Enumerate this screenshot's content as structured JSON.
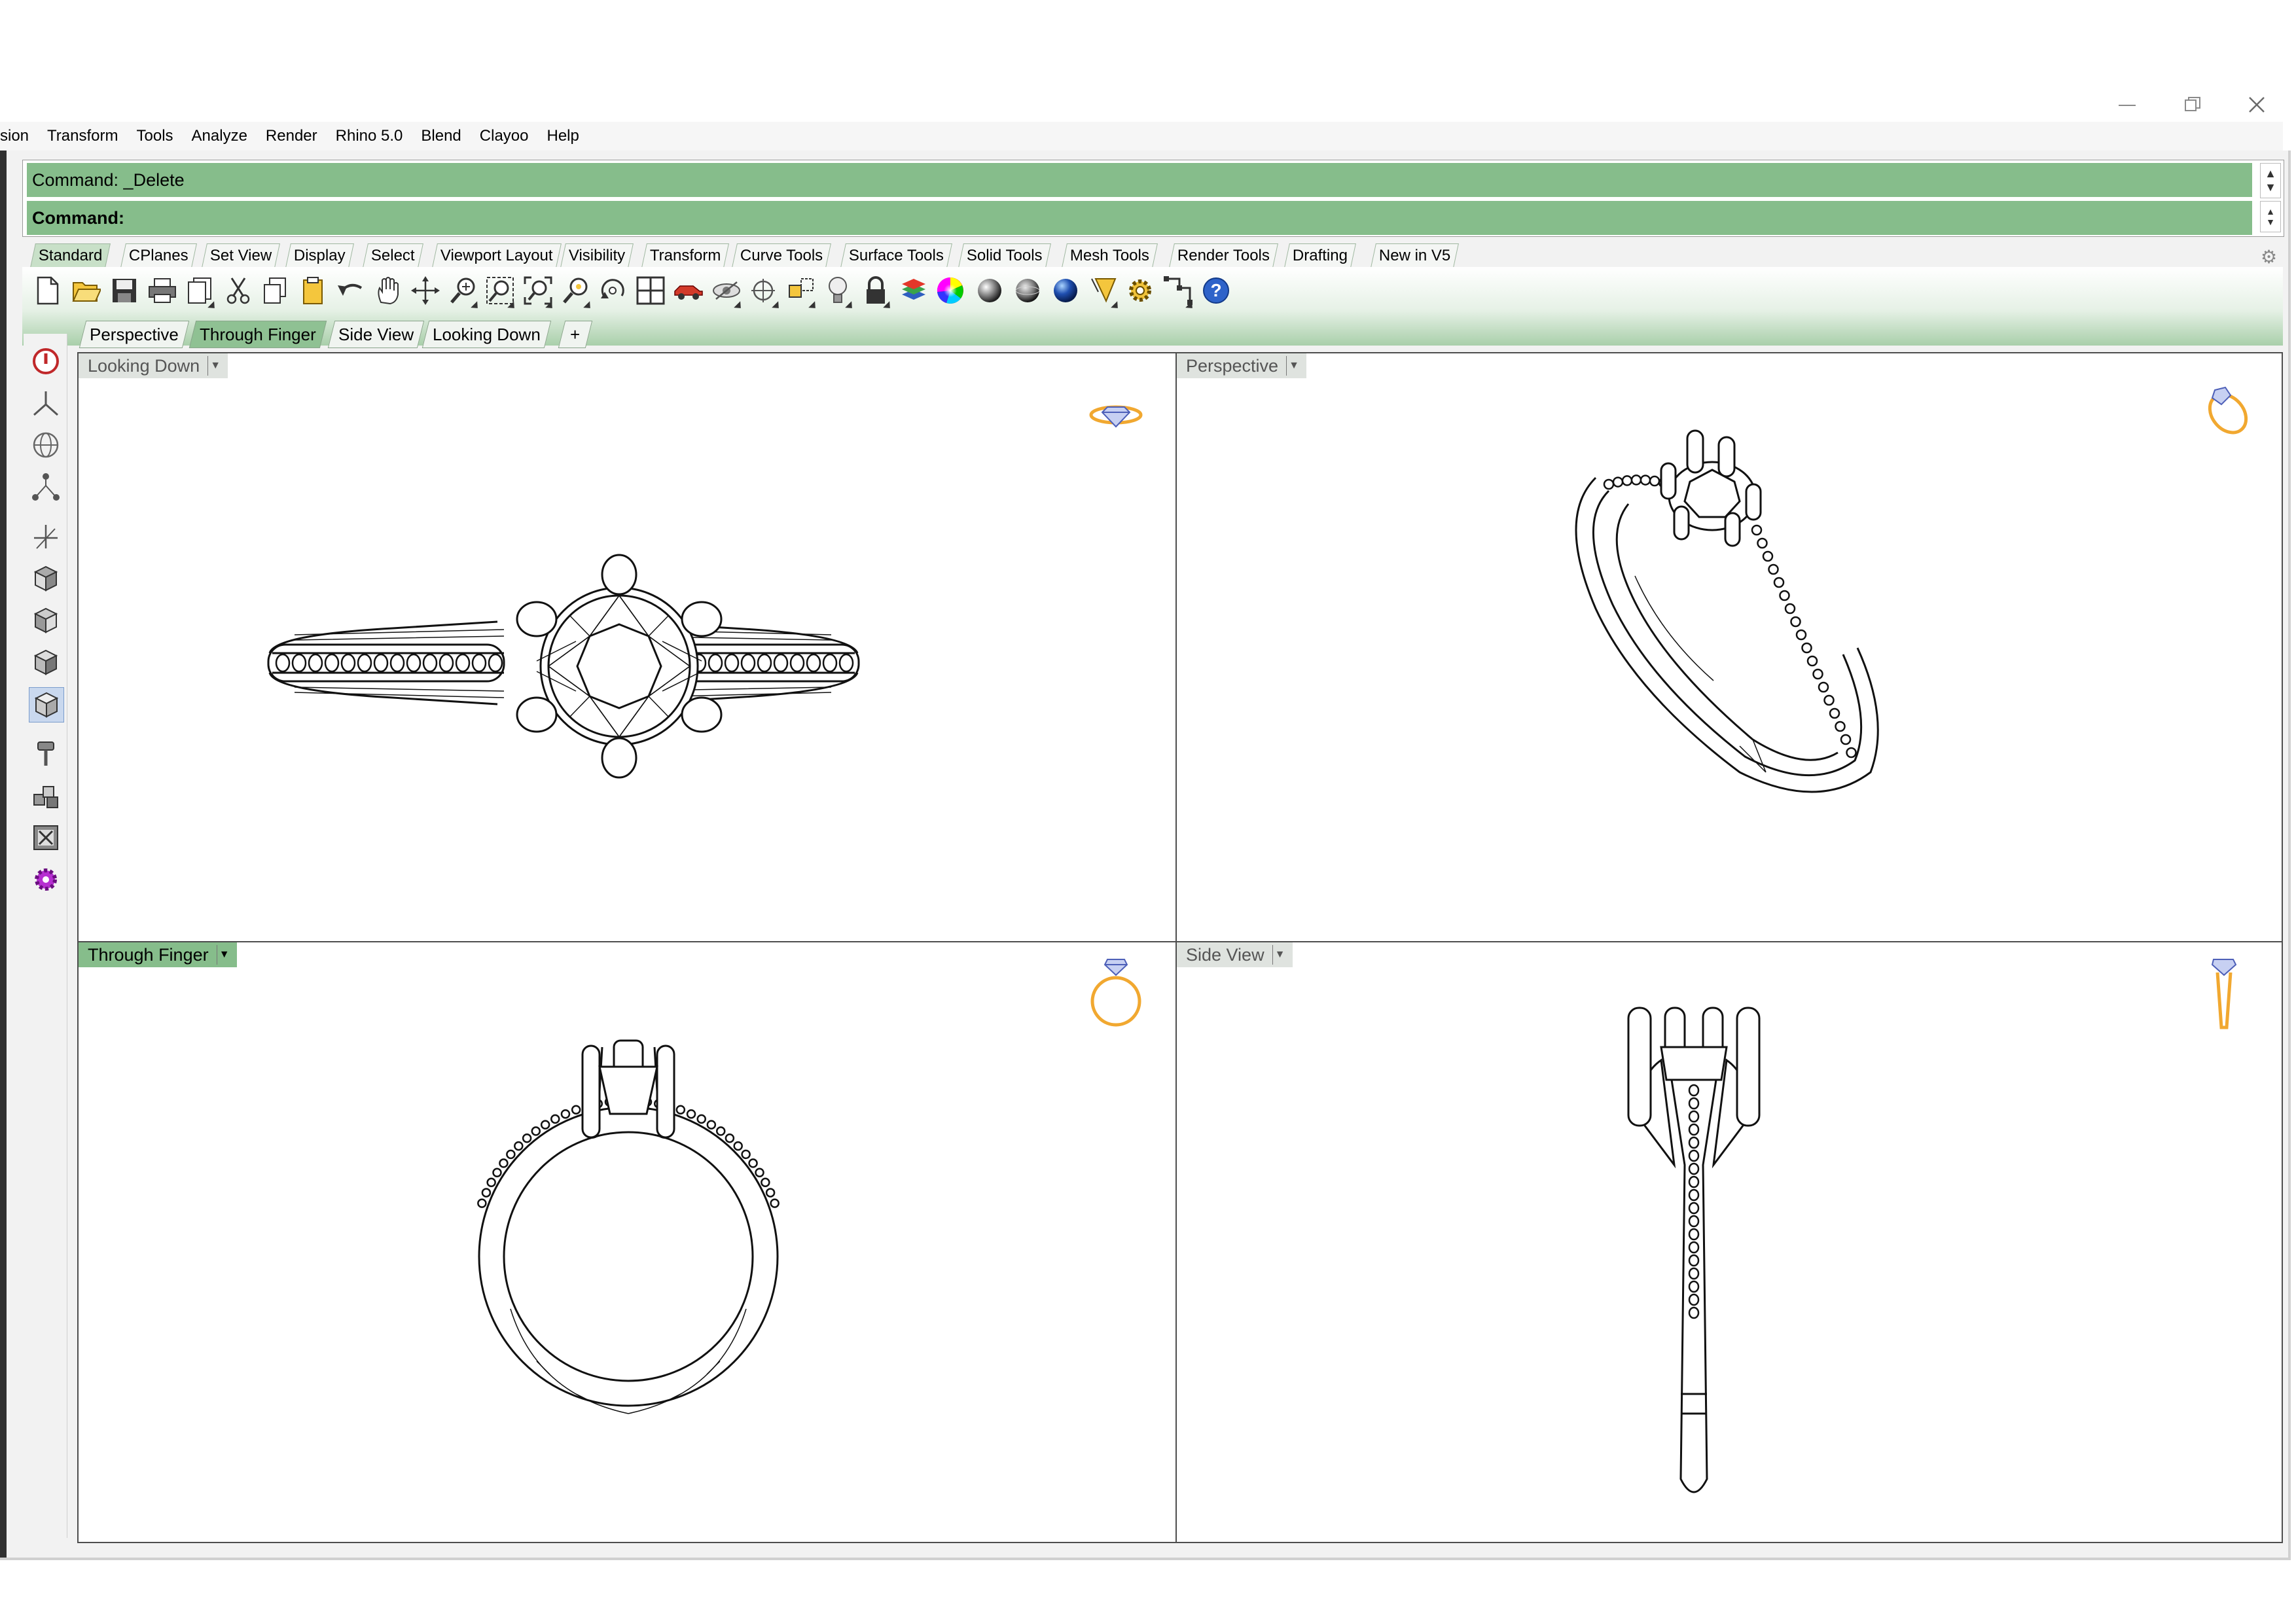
{
  "window": {
    "controls": [
      {
        "name": "minimize-button",
        "glyph": "—"
      },
      {
        "name": "restore-button",
        "glyph": "❐"
      },
      {
        "name": "close-button",
        "glyph": "✕"
      }
    ]
  },
  "menubar": {
    "items": [
      "sion",
      "Transform",
      "Tools",
      "Analyze",
      "Render",
      "Rhino 5.0",
      "Blend",
      "Clayoo",
      "Help"
    ]
  },
  "command": {
    "history": "Command: _Delete",
    "prompt": "Command:",
    "bg_color": "#86bd8b"
  },
  "toolbar_tabs": {
    "items": [
      "Standard",
      "CPlanes",
      "Set View",
      "Display",
      "Select",
      "Viewport Layout",
      "Visibility",
      "Transform",
      "Curve Tools",
      "Surface Tools",
      "Solid Tools",
      "Mesh Tools",
      "Render Tools",
      "Drafting",
      "New in V5"
    ],
    "active": "Standard"
  },
  "toolbar_icons": [
    "new-file-icon",
    "open-file-icon",
    "save-icon",
    "print-icon",
    "import-icon",
    "cut-icon",
    "copy-icon",
    "paste-icon",
    "undo-icon",
    "pan-hand-icon",
    "move-icon",
    "zoom-window-icon",
    "zoom-extents-icon",
    "zoom-all-icon",
    "zoom-selected-icon",
    "rotate-view-icon",
    "four-viewports-icon",
    "car-icon",
    "hide-icon",
    "lock-objects-icon",
    "light-bulb-icon",
    "padlock-icon",
    "layers-icon",
    "color-wheel-icon",
    "sphere-wireframe-icon",
    "sphere-shaded-icon",
    "sphere-rendered-icon",
    "render-icon",
    "options-gear-icon",
    "selection-filter-icon",
    "help-icon"
  ],
  "left_toolbar_icons": [
    "stop-icon",
    "axes-icon",
    "globe-icon",
    "points-icon",
    "gumball-icon",
    "box-top-icon",
    "box-front-icon",
    "box-right-icon",
    "box-perspective-icon",
    "hammer-icon",
    "blocks-icon",
    "box-x-icon",
    "purple-gear-icon"
  ],
  "viewport_tabs": {
    "items": [
      "Perspective",
      "Through Finger",
      "Side View",
      "Looking Down"
    ],
    "active": "Through Finger",
    "add_label": "+"
  },
  "viewports": {
    "looking_down": {
      "title": "Looking Down",
      "active": false
    },
    "perspective": {
      "title": "Perspective",
      "active": false
    },
    "through_finger": {
      "title": "Through Finger",
      "active": true
    },
    "side_view": {
      "title": "Side View",
      "active": false
    }
  },
  "colors": {
    "accent_green": "#86bd8b",
    "widget_orange": "#f1a830",
    "widget_blue": "#4d5fb8",
    "drawing": "#111111"
  }
}
